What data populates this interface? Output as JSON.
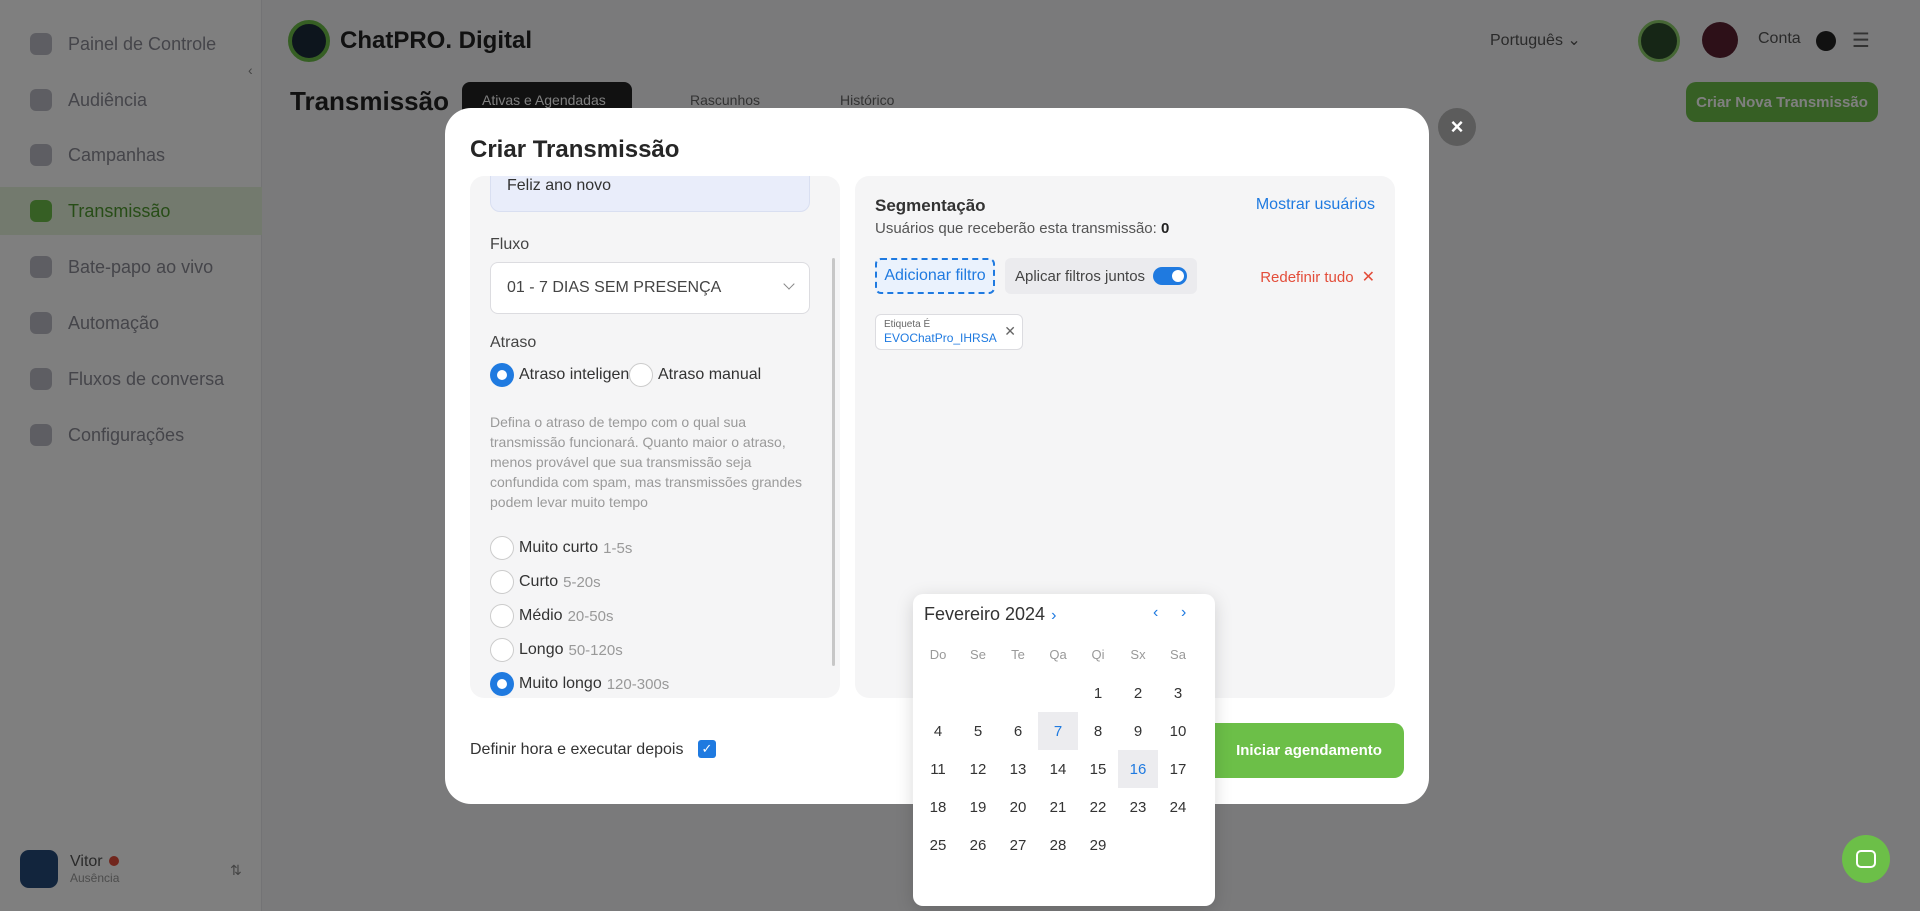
{
  "sidebar": {
    "items": [
      {
        "label": "Painel de Controle",
        "active": false
      },
      {
        "label": "Audiência",
        "active": false
      },
      {
        "label": "Campanhas",
        "active": false
      },
      {
        "label": "Transmissão",
        "active": true
      },
      {
        "label": "Bate-papo ao vivo",
        "active": false
      },
      {
        "label": "Automação",
        "active": false
      },
      {
        "label": "Fluxos de conversa",
        "active": false
      },
      {
        "label": "Configurações",
        "active": false
      }
    ],
    "user": {
      "name": "Vitor",
      "status": "Ausência"
    }
  },
  "topbar": {
    "brand": "ChatPRO. Digital",
    "language": "Português",
    "user": "Conta"
  },
  "page": {
    "title": "Transmissão",
    "tabs": [
      "Ativas e Agendadas",
      "Rascunhos",
      "Histórico"
    ],
    "new_button": "Criar Nova Transmissão"
  },
  "modal": {
    "title": "Criar Transmissão",
    "message_preview": "Feliz ano novo",
    "flow": {
      "label": "Fluxo",
      "value": "01 - 7 DIAS SEM PRESENÇA"
    },
    "delay": {
      "label": "Atraso",
      "options": [
        {
          "label": "Atraso inteligente",
          "selected": true
        },
        {
          "label": "Atraso manual",
          "selected": false
        }
      ],
      "description": "Defina o atraso de tempo com o qual sua transmissão funcionará. Quanto maior o atraso, menos provável que sua transmissão seja confundida com spam, mas transmissões grandes podem levar muito tempo",
      "levels": [
        {
          "label": "Muito curto",
          "range": "1-5s",
          "selected": false
        },
        {
          "label": "Curto",
          "range": "5-20s",
          "selected": false
        },
        {
          "label": "Médio",
          "range": "20-50s",
          "selected": false
        },
        {
          "label": "Longo",
          "range": "50-120s",
          "selected": false
        },
        {
          "label": "Muito longo",
          "range": "120-300s",
          "selected": true
        }
      ]
    },
    "segmentation": {
      "title": "Segmentação",
      "show_users": "Mostrar usuários",
      "recipients_label": "Usuários que receberão esta transmissão:",
      "recipients_count": "0",
      "add_filter": "Adicionar filtro",
      "apply_joint": "Aplicar filtros juntos",
      "apply_joint_on": true,
      "reset_all": "Redefinir tudo",
      "filter": {
        "category": "Etiqueta",
        "operator": "É",
        "value": "EVOChatPro_IHRSA"
      }
    },
    "schedule_label": "Definir hora e executar depois",
    "schedule_checked": true,
    "start_button": "Iniciar agendamento"
  },
  "datepicker": {
    "month_label": "Fevereiro 2024",
    "weekdays": [
      "Do",
      "Se",
      "Te",
      "Qa",
      "Qi",
      "Sx",
      "Sa"
    ],
    "first_weekday_index": 4,
    "days_in_month": 29,
    "highlighted_days": [
      7,
      16
    ]
  },
  "colors": {
    "accent_blue": "#1f7ae0",
    "brand_green": "#6cbf48",
    "danger_red": "#e34d3a"
  }
}
